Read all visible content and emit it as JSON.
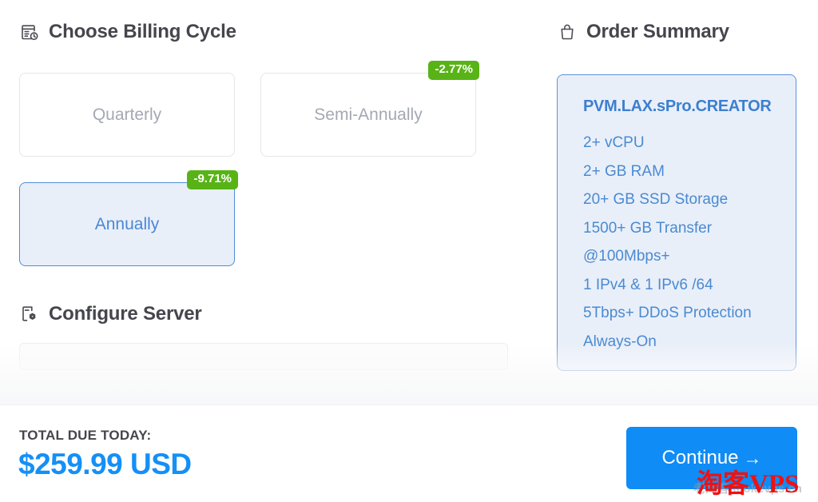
{
  "billing": {
    "heading": "Choose Billing Cycle",
    "heading_icon": "calendar-clock-icon",
    "options": [
      {
        "label": "Quarterly",
        "badge": "",
        "selected": false
      },
      {
        "label": "Semi-Annually",
        "badge": "-2.77%",
        "selected": false
      },
      {
        "label": "Annually",
        "badge": "-9.71%",
        "selected": true
      }
    ]
  },
  "configure": {
    "heading": "Configure Server",
    "heading_icon": "document-gear-icon"
  },
  "order_summary": {
    "heading": "Order Summary",
    "heading_icon": "shopping-bag-icon",
    "plan_name": "PVM.LAX.sPro.CREATOR",
    "specs": [
      "2+ vCPU",
      "2+ GB RAM",
      "20+ GB SSD Storage",
      "1500+ GB Transfer @100Mbps+",
      "1 IPv4 & 1 IPv6 /64",
      "5Tbps+ DDoS Protection Always-On"
    ]
  },
  "footer": {
    "total_label": "TOTAL DUE TODAY:",
    "total_amount": "$259.99 USD",
    "continue_label": "Continue",
    "continue_arrow": "→"
  },
  "watermarks": {
    "primary": "淘客VPS",
    "secondary": "老淘客 taokevps.cn"
  },
  "colors": {
    "accent_blue": "#0f8cf5",
    "badge_green": "#58b317",
    "card_blue": "#4a8ad2",
    "heading_gray": "#45454d",
    "watermark_red": "#ef1111"
  }
}
